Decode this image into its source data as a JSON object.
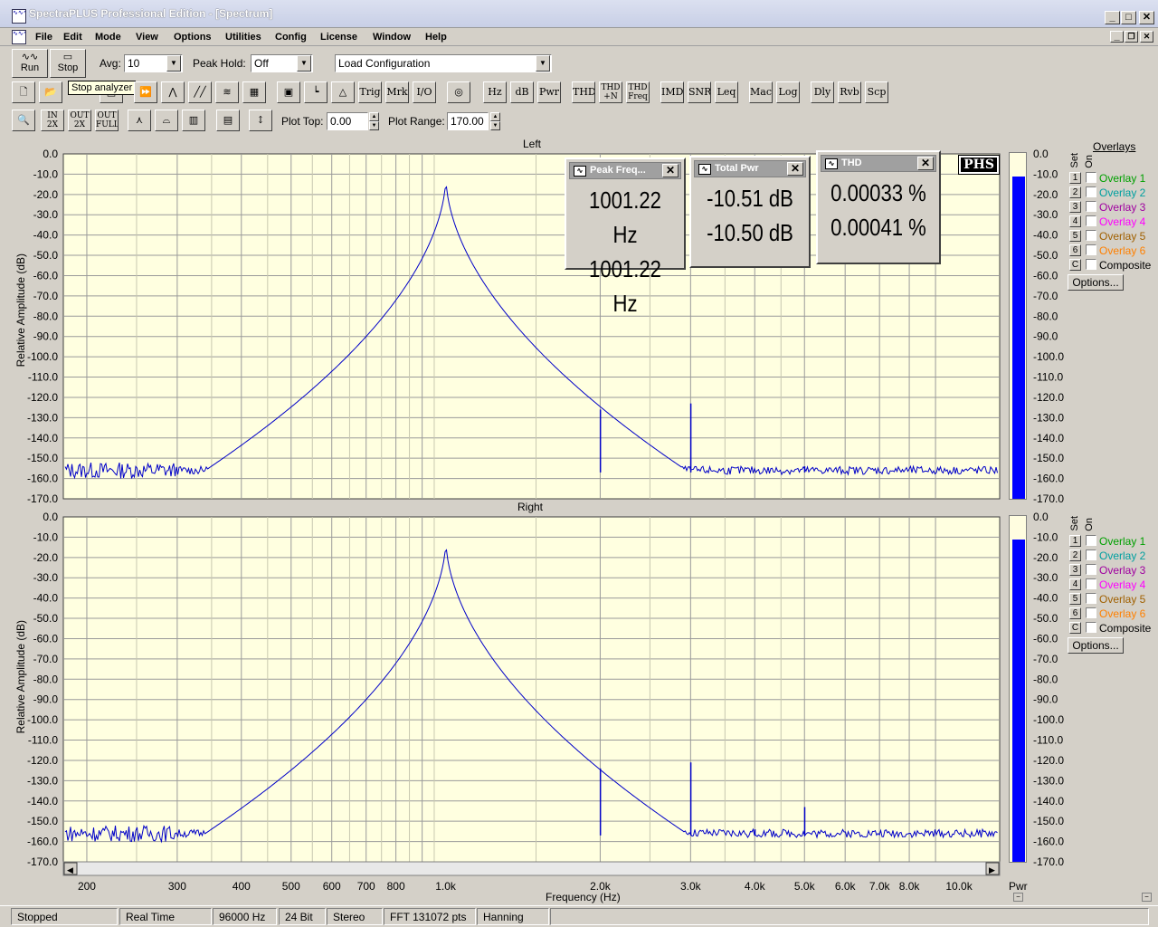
{
  "app": {
    "title": "SpectraPLUS Professional Edition - [Spectrum]"
  },
  "menu": [
    "File",
    "Edit",
    "Mode",
    "View",
    "Options",
    "Utilities",
    "Config",
    "License",
    "Window",
    "Help"
  ],
  "toolbar1": {
    "run": "Run",
    "stop": "Stop",
    "avg_label": "Avg:",
    "avg_value": "10",
    "peak_label": "Peak Hold:",
    "peak_value": "Off",
    "load_config": "Load Configuration"
  },
  "tooltip": "Stop analyzer",
  "toolbar2": [
    "Trig",
    "Mrk",
    "I/O",
    "Hz",
    "dB",
    "Pwr",
    "THD",
    "THD\n+N",
    "THD\nFreq",
    "IMD",
    "SNR",
    "Leq",
    "Mac",
    "Log",
    "Dly",
    "Rvb",
    "Scp"
  ],
  "toolbar3": {
    "plot_top_label": "Plot Top:",
    "plot_top_value": "0.00",
    "plot_range_label": "Plot Range:",
    "plot_range_value": "170.00"
  },
  "zoom_buttons": [
    "IN\n2X",
    "OUT\n2X",
    "OUT\nFULL"
  ],
  "plots": {
    "left_title": "Left",
    "right_title": "Right",
    "ylabel": "Relative Amplitude (dB)",
    "xlabel": "Frequency (Hz)",
    "yticks": [
      "0.0",
      "-10.0",
      "-20.0",
      "-30.0",
      "-40.0",
      "-50.0",
      "-60.0",
      "-70.0",
      "-80.0",
      "-90.0",
      "-100.0",
      "-110.0",
      "-120.0",
      "-130.0",
      "-140.0",
      "-150.0",
      "-160.0",
      "-170.0"
    ],
    "xticks": [
      "200",
      "300",
      "400",
      "500",
      "600",
      "700",
      "800",
      "1.0k",
      "2.0k",
      "3.0k",
      "4.0k",
      "5.0k",
      "6.0k",
      "7.0k",
      "8.0k",
      "10.0k"
    ],
    "logo": "PHS"
  },
  "readouts": [
    {
      "title": "Peak Freq...",
      "v1": "1001.22 Hz",
      "v2": "1001.22 Hz"
    },
    {
      "title": "Total Pwr",
      "v1": "-10.51 dB",
      "v2": "-10.50 dB"
    },
    {
      "title": "THD",
      "v1": "0.00033 %",
      "v2": "0.00041 %"
    }
  ],
  "meter": {
    "label": "Pwr",
    "left_level_db": -10.5,
    "right_level_db": -10.5
  },
  "overlays": {
    "title": "Overlays",
    "set": "Set",
    "on": "On",
    "items": [
      {
        "n": "1",
        "name": "Overlay 1",
        "color": "#00a000"
      },
      {
        "n": "2",
        "name": "Overlay 2",
        "color": "#00a0a0"
      },
      {
        "n": "3",
        "name": "Overlay 3",
        "color": "#a000a0"
      },
      {
        "n": "4",
        "name": "Overlay 4",
        "color": "#ff00ff"
      },
      {
        "n": "5",
        "name": "Overlay 5",
        "color": "#a06000"
      },
      {
        "n": "6",
        "name": "Overlay 6",
        "color": "#ff8000"
      },
      {
        "n": "C",
        "name": "Composite",
        "color": "#000000"
      }
    ],
    "options": "Options..."
  },
  "status": [
    "Stopped",
    "Real Time",
    "96000 Hz",
    "24 Bit",
    "Stereo",
    "FFT 131072 pts",
    "Hanning"
  ],
  "chart_data": [
    {
      "type": "line",
      "title": "Left",
      "xlabel": "Frequency (Hz)",
      "ylabel": "Relative Amplitude (dB)",
      "xscale": "log",
      "xlim": [
        180,
        12000
      ],
      "ylim": [
        -170,
        0
      ],
      "series": [
        {
          "values_desc": "noise floor",
          "x": [
            180,
            300,
            500,
            800,
            950,
            1001,
            1050,
            1200,
            2000,
            2002,
            2200,
            3000,
            3003,
            3200,
            5000,
            5005,
            12000
          ],
          "y": [
            -156,
            -157,
            -156,
            -154,
            -148,
            -11,
            -145,
            -154,
            -156,
            -126,
            -157,
            -157,
            -123,
            -157,
            -157,
            -154,
            -157
          ]
        }
      ]
    },
    {
      "type": "line",
      "title": "Right",
      "xlabel": "Frequency (Hz)",
      "ylabel": "Relative Amplitude (dB)",
      "xscale": "log",
      "xlim": [
        180,
        12000
      ],
      "ylim": [
        -170,
        0
      ],
      "series": [
        {
          "values_desc": "noise floor",
          "x": [
            180,
            300,
            500,
            800,
            950,
            1001,
            1050,
            1200,
            2000,
            2002,
            2200,
            3000,
            3003,
            3200,
            4000,
            4005,
            5000,
            5005,
            12000
          ],
          "y": [
            -155,
            -157,
            -156,
            -154,
            -146,
            -11,
            -145,
            -154,
            -156,
            -124,
            -157,
            -157,
            -121,
            -157,
            -157,
            -154,
            -157,
            -143,
            -157
          ]
        }
      ]
    }
  ]
}
